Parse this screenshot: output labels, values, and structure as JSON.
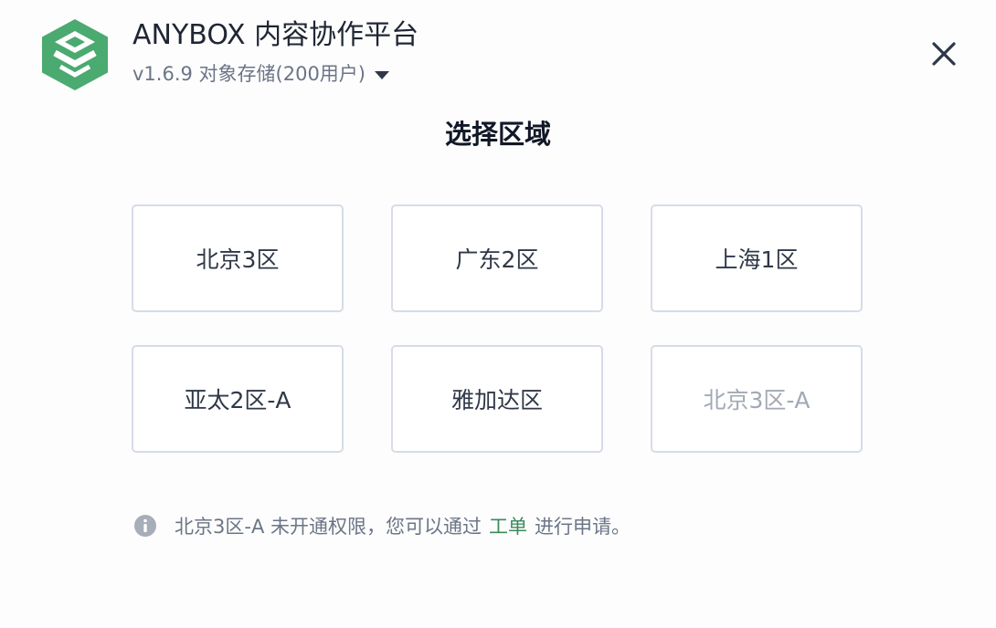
{
  "header": {
    "app_title": "ANYBOX 内容协作平台",
    "version_label": "v1.6.9 对象存储(200用户)",
    "logo_icon": "anybox-logo-icon",
    "version_dropdown_icon": "caret-down-icon",
    "close_icon": "close-icon"
  },
  "page_title": "选择区域",
  "regions": [
    {
      "label": "北京3区",
      "enabled": true
    },
    {
      "label": "广东2区",
      "enabled": true
    },
    {
      "label": "上海1区",
      "enabled": true
    },
    {
      "label": "亚太2区-A",
      "enabled": true
    },
    {
      "label": "雅加达区",
      "enabled": true
    },
    {
      "label": "北京3区-A",
      "enabled": false
    }
  ],
  "notice": {
    "icon": "info-icon",
    "text_before": "北京3区-A 未开通权限，您可以通过",
    "link_text": "工单",
    "text_after": "进行申请。"
  },
  "colors": {
    "brand_green": "#4aaa70",
    "link_green": "#3b8a5a",
    "disabled_text": "#a2a9b5"
  }
}
